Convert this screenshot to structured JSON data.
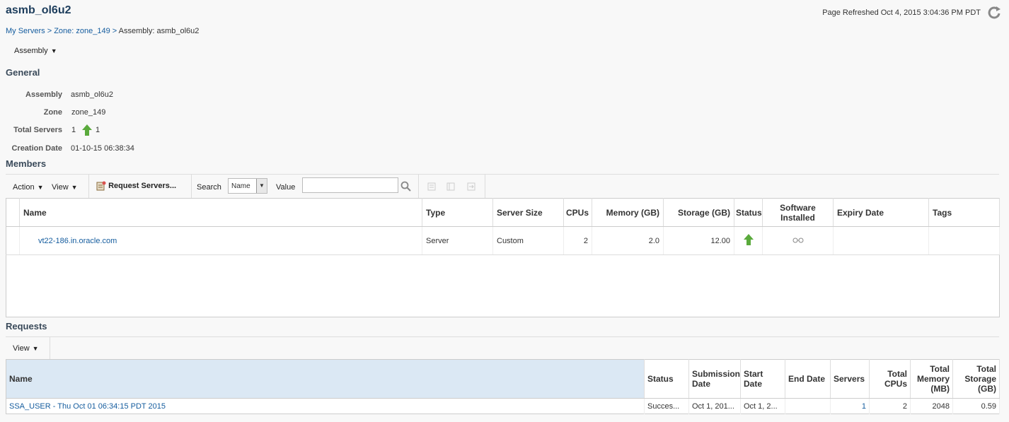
{
  "page": {
    "title": "asmb_ol6u2",
    "refreshed_label": "Page Refreshed",
    "refreshed_value": "Oct 4, 2015 3:04:36 PM PDT"
  },
  "breadcrumb": {
    "item1": "My Servers",
    "sep": ">",
    "item2": "Zone: zone_149",
    "current": "Assembly: asmb_ol6u2"
  },
  "assembly_menu": "Assembly",
  "general": {
    "heading": "General",
    "assembly_label": "Assembly",
    "assembly_value": "asmb_ol6u2",
    "zone_label": "Zone",
    "zone_value": "zone_149",
    "total_servers_label": "Total Servers",
    "total_servers_value": "1",
    "total_servers_up": "1",
    "creation_label": "Creation Date",
    "creation_value": "01-10-15 06:38:34"
  },
  "members": {
    "heading": "Members",
    "toolbar": {
      "action": "Action",
      "view": "View",
      "request_servers": "Request Servers...",
      "search_label": "Search",
      "search_field": "Name",
      "value_label": "Value",
      "value_input": ""
    },
    "columns": [
      "Name",
      "Type",
      "Server Size",
      "CPUs",
      "Memory (GB)",
      "Storage (GB)",
      "Status",
      "Software Installed",
      "Expiry Date",
      "Tags"
    ],
    "rows": [
      {
        "name": "vt22-186.in.oracle.com",
        "type": "Server",
        "size": "Custom",
        "cpus": "2",
        "memory": "2.0",
        "storage": "12.00",
        "status": "up",
        "software_icon": "glasses-icon",
        "expiry": "",
        "tags": ""
      }
    ]
  },
  "requests": {
    "heading": "Requests",
    "view": "View",
    "columns": {
      "name": "Name",
      "status": "Status",
      "submission": "Submission Date",
      "start": "Start Date",
      "end": "End Date",
      "servers": "Servers",
      "total_cpus": "Total CPUs",
      "total_memory": "Total Memory (MB)",
      "total_storage": "Total Storage (GB)"
    },
    "rows": [
      {
        "name": "SSA_USER - Thu Oct 01 06:34:15 PDT 2015",
        "status": "Succes...",
        "submission": "Oct 1, 201...",
        "start": "Oct 1, 2...",
        "end": "",
        "servers": "1",
        "total_cpus": "2",
        "total_memory": "2048",
        "total_storage": "0.59"
      }
    ]
  },
  "colors": {
    "link": "#145c9e",
    "status_up": "#5aaa3c",
    "selected_header": "#dbe8f4"
  }
}
